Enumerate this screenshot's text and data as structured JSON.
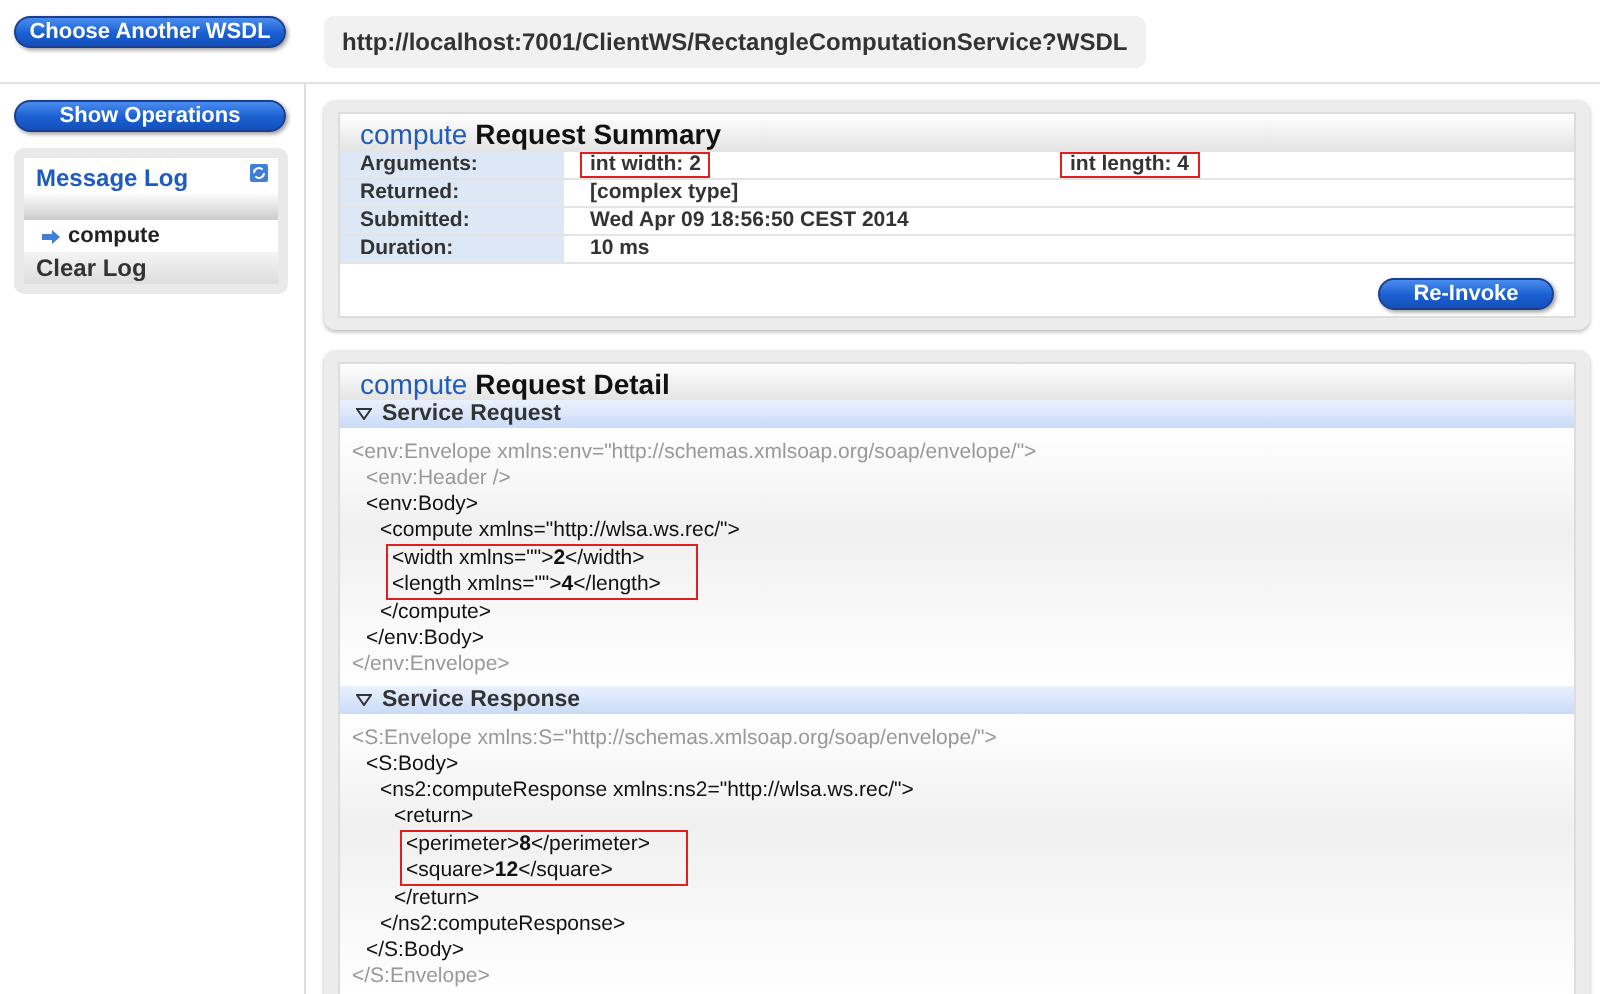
{
  "top_bar": {
    "choose_button": "Choose Another WSDL",
    "wsdl_url": "http://localhost:7001/ClientWS/RectangleComputationService?WSDL"
  },
  "sidebar": {
    "show_operations_button": "Show Operations",
    "message_log": {
      "title": "Message Log",
      "entries": [
        {
          "label": "compute",
          "selected": true
        }
      ],
      "clear_label": "Clear Log"
    }
  },
  "summary": {
    "operation": "compute",
    "title": "Request Summary",
    "rows": [
      {
        "label": "Arguments:",
        "values": [
          {
            "text": "int width: 2",
            "highlighted": true
          },
          {
            "text": "int length: 4",
            "highlighted": true
          }
        ]
      },
      {
        "label": "Returned:",
        "values": [
          {
            "text": "[complex type]",
            "highlighted": false
          }
        ]
      },
      {
        "label": "Submitted:",
        "values": [
          {
            "text": "Wed Apr 09 18:56:50 CEST 2014",
            "highlighted": false
          }
        ]
      },
      {
        "label": "Duration:",
        "values": [
          {
            "text": "10 ms",
            "highlighted": false
          }
        ]
      }
    ],
    "reinvoke_button": "Re-Invoke"
  },
  "detail": {
    "operation": "compute",
    "title": "Request Detail",
    "sections": [
      {
        "title": "Service Request",
        "expanded": true,
        "lines": [
          {
            "kind": "line",
            "text": "<env:Envelope xmlns:env=\"http://schemas.xmlsoap.org/soap/envelope/\">",
            "faded": true,
            "children": [
              {
                "kind": "line",
                "text": "<env:Header />",
                "faded": true
              },
              {
                "kind": "line",
                "text": "<env:Body>",
                "faded": false,
                "children": [
                  {
                    "kind": "line",
                    "text": "<compute xmlns=\"http://wlsa.ws.rec/\">",
                    "faded": false,
                    "children": [
                      {
                        "kind": "highlight",
                        "children": [
                          {
                            "kind": "line",
                            "text": "<width xmlns=\"\">**2**</width>",
                            "faded": false
                          },
                          {
                            "kind": "line",
                            "text": "<length xmlns=\"\">**4**</length>",
                            "faded": false
                          }
                        ]
                      }
                    ]
                  },
                  {
                    "kind": "line",
                    "text": "</compute>",
                    "faded": false
                  }
                ]
              },
              {
                "kind": "line",
                "text": "</env:Body>",
                "faded": false
              }
            ]
          },
          {
            "kind": "line",
            "text": "</env:Envelope>",
            "faded": true
          }
        ]
      },
      {
        "title": "Service Response",
        "expanded": true,
        "lines": [
          {
            "kind": "line",
            "text": "<S:Envelope xmlns:S=\"http://schemas.xmlsoap.org/soap/envelope/\">",
            "faded": true,
            "children": [
              {
                "kind": "line",
                "text": "<S:Body>",
                "faded": false,
                "children": [
                  {
                    "kind": "line",
                    "text": "<ns2:computeResponse xmlns:ns2=\"http://wlsa.ws.rec/\">",
                    "faded": false,
                    "children": [
                      {
                        "kind": "line",
                        "text": "<return>",
                        "faded": false,
                        "children": [
                          {
                            "kind": "highlight",
                            "children": [
                              {
                                "kind": "line",
                                "text": "<perimeter>**8**</perimeter>",
                                "faded": false
                              },
                              {
                                "kind": "line",
                                "text": "<square>**12**</square>",
                                "faded": false
                              }
                            ]
                          }
                        ]
                      },
                      {
                        "kind": "line",
                        "text": "</return>",
                        "faded": false
                      }
                    ]
                  },
                  {
                    "kind": "line",
                    "text": "</ns2:computeResponse>",
                    "faded": false
                  }
                ]
              },
              {
                "kind": "line",
                "text": "</S:Body>",
                "faded": false
              }
            ]
          },
          {
            "kind": "line",
            "text": "</S:Envelope>",
            "faded": true
          }
        ]
      }
    ]
  }
}
